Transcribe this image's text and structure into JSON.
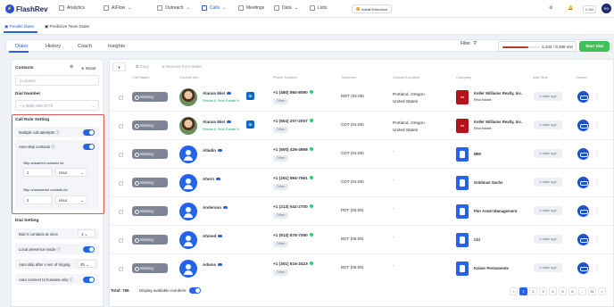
{
  "brand": {
    "name": "FlashRev"
  },
  "top_nav": [
    {
      "label": "Analytics"
    },
    {
      "label": "AIFlow"
    },
    {
      "label": "Outreach"
    },
    {
      "label": "Calls"
    },
    {
      "label": "Meetings"
    },
    {
      "label": "Data"
    },
    {
      "label": "Lists"
    }
  ],
  "install_extension": "Install Extension",
  "credits": "0.0M",
  "user_initials": "RD",
  "sub_tabs": [
    {
      "label": "Parallel Dialer"
    },
    {
      "label": "Predictive Team Dialer"
    }
  ],
  "dialer_tabs": [
    {
      "label": "Dialer"
    },
    {
      "label": "History"
    },
    {
      "label": "Coach"
    },
    {
      "label": "Insights"
    }
  ],
  "filter_label": "Filter",
  "minutes": {
    "text": "6,344 / 9,338 min",
    "fraction": 0.68
  },
  "start_dial": "Start Dial",
  "left_panel": {
    "contacts_label": "Contacts",
    "import_label": "Import",
    "contacts_placeholder": "Contacts",
    "dial_number_label": "Dial Number",
    "dial_number_value": "+1 (888) 865-3775",
    "call_rule_title": "Call Rule Setting",
    "multiple_call_attempts": "Multiple call attempts",
    "auto_skip_contacts": "Auto-skip contacts",
    "skip_answered_label": "Skip answered contacts for",
    "skip_answered_value": "1",
    "skip_answered_unit": "Hour",
    "skip_unanswered_label": "Skip unanswered contacts for",
    "skip_unanswered_value": "2",
    "skip_unanswered_unit": "Hour",
    "dial_setting_title": "Dial Setting",
    "dial_x_contacts": "Dial X contacts at once",
    "dial_x_value": "1",
    "local_presence": "Local presence mode",
    "auto_skip_ringing": "Auto skip after x sec of ringing",
    "ringing_value": "45",
    "auto_connect": "Auto connect to humans only"
  },
  "toolbar": {
    "copy": "Copy",
    "remove": "Remove from Dialer"
  },
  "columns": [
    "Call Status",
    "Contact Info",
    "Phone Number",
    "Timezone",
    "Contact Location",
    "Company",
    "Add Time",
    "Owner"
  ],
  "rows": [
    {
      "status": "Waiting",
      "name": "Alanna Miel",
      "title": "Rental & Real Estate B",
      "avatar": "photo",
      "linkedin": true,
      "phone": "+1 (480) 860-8090",
      "phone_type": "Other",
      "tz": "MST (02:09)",
      "loc1": "Portland, Oregon",
      "loc2": "United States",
      "company": "Keller Williams Realty, Inc.",
      "industry": "Real Estate",
      "logo": "kw",
      "added": "3 days ago"
    },
    {
      "status": "Waiting",
      "name": "Alanna Miel",
      "title": "Rental & Real Estate B",
      "avatar": "photo",
      "linkedin": true,
      "phone": "+1 (504) 207-2007",
      "phone_type": "Other",
      "tz": "CDT (04:09)",
      "loc1": "Portland, Oregon",
      "loc2": "United States",
      "company": "Keller Williams Realty, Inc.",
      "industry": "Real Estate",
      "logo": "kw",
      "added": "3 days ago"
    },
    {
      "status": "Waiting",
      "name": "Alladin",
      "title": "",
      "avatar": "user",
      "linkedin": false,
      "phone": "+1 (800) 426-4968",
      "phone_type": "Other",
      "tz": "CDT (04:09)",
      "loc1": "-",
      "loc2": "",
      "company": "IBM",
      "industry": "",
      "logo": "doc",
      "added": "3 days ago"
    },
    {
      "status": "Waiting",
      "name": "Ahern",
      "title": "",
      "avatar": "user",
      "linkedin": false,
      "phone": "+1 (251) 894-7561",
      "phone_type": "Other",
      "tz": "CDT (04:09)",
      "loc1": "-",
      "loc2": "",
      "company": "Goldman Sachs",
      "industry": "",
      "logo": "doc",
      "added": "3 days ago"
    },
    {
      "status": "Waiting",
      "name": "Anderson",
      "title": "",
      "avatar": "user",
      "linkedin": false,
      "phone": "+1 (213) 542-2700",
      "phone_type": "Other",
      "tz": "PDT (02:09)",
      "loc1": "-",
      "loc2": "",
      "company": "Pier Asset Management",
      "industry": "",
      "logo": "doc",
      "added": "3 days ago"
    },
    {
      "status": "Waiting",
      "name": "Ahmed",
      "title": "",
      "avatar": "user",
      "linkedin": false,
      "phone": "+1 (913) 878-7050",
      "phone_type": "Other",
      "tz": "EDT (05:09)",
      "loc1": "-",
      "loc2": "",
      "company": "Citi",
      "industry": "",
      "logo": "doc",
      "added": "3 days ago"
    },
    {
      "status": "Waiting",
      "name": "Adams",
      "title": "",
      "avatar": "user",
      "linkedin": false,
      "phone": "+1 (301) 816-2423",
      "phone_type": "Other",
      "tz": "EDT (05:09)",
      "loc1": "-",
      "loc2": "",
      "company": "Kaiser Permanente",
      "industry": "",
      "logo": "doc",
      "added": "3 days ago"
    }
  ],
  "footer": {
    "total": "Total: 766",
    "display_numbers": "Display available numbers"
  },
  "pagination": [
    "<",
    "1",
    "2",
    "3",
    "4",
    "5",
    "6",
    "...",
    "31",
    ">"
  ]
}
